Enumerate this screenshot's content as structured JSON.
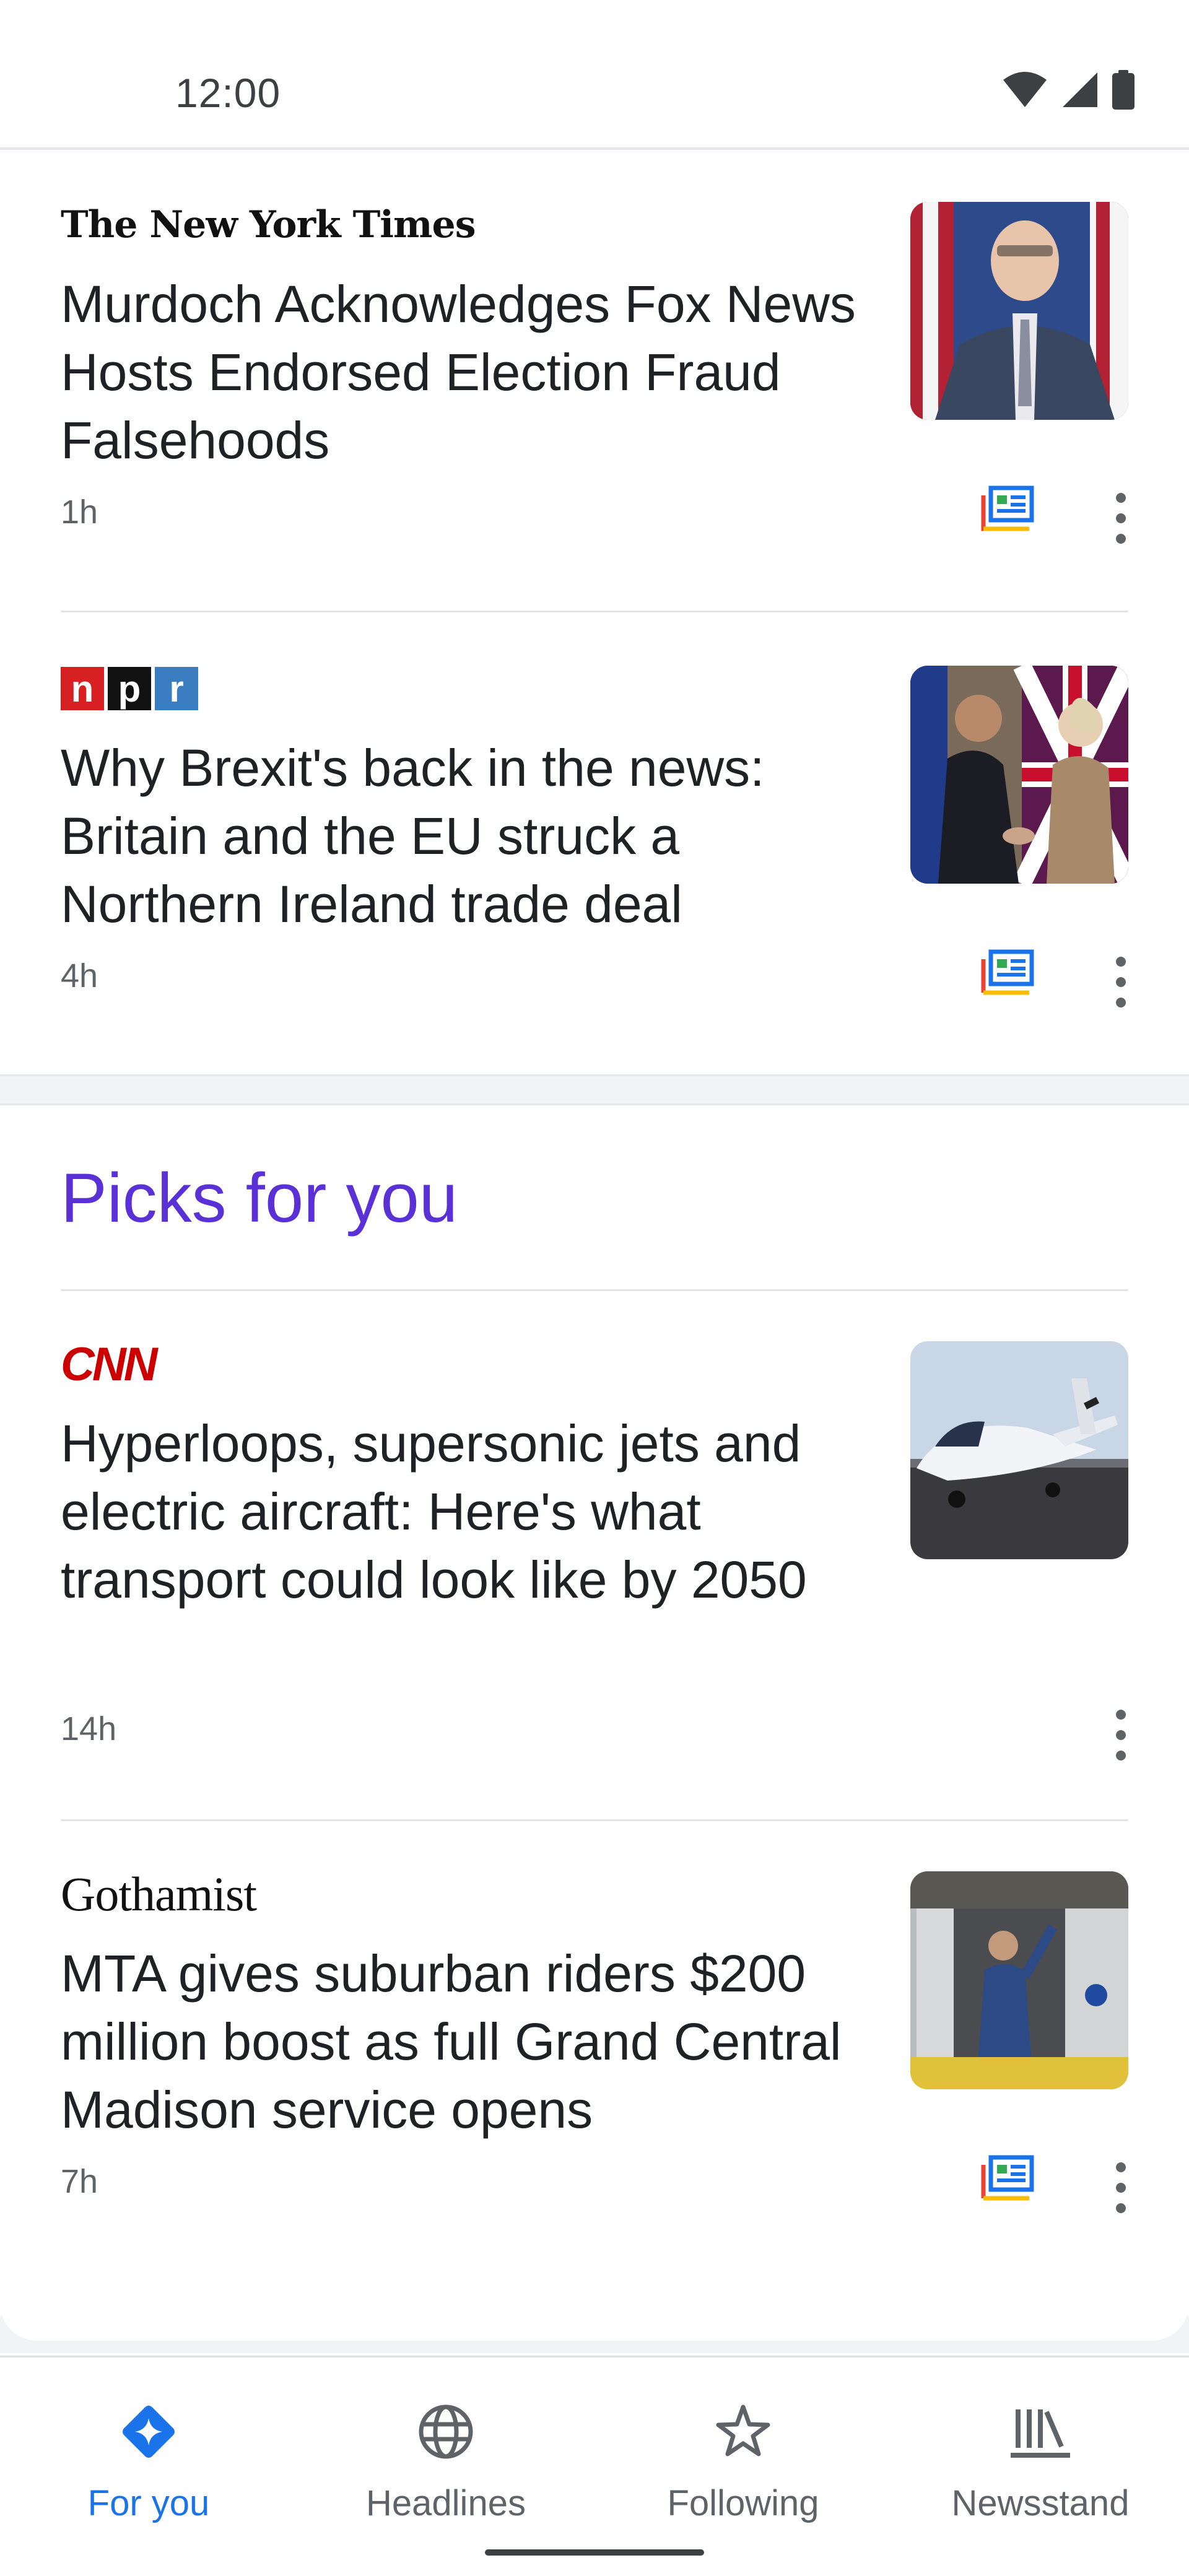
{
  "status_bar": {
    "time": "12:00",
    "icons": [
      "wifi-icon",
      "signal-icon",
      "battery-icon"
    ]
  },
  "feed": {
    "articles": [
      {
        "source": "The New York Times",
        "headline": "Murdoch Acknowledges Fox News Hosts Endorsed Election Fraud Falsehoods",
        "time": "1h",
        "has_full_coverage": true,
        "thumbnail": "man in suit in front of american flags"
      },
      {
        "source": "npr",
        "headline": "Why Brexit's back in the news: Britain and the EU struck a Northern Ireland trade deal",
        "time": "4h",
        "has_full_coverage": true,
        "thumbnail": "two leaders shaking hands in front of flags"
      }
    ]
  },
  "picks": {
    "title": "Picks for you",
    "articles": [
      {
        "source": "CNN",
        "headline": "Hyperloops, supersonic jets and electric aircraft: Here's what transport could look like by 2050",
        "time": "14h",
        "has_full_coverage": false,
        "thumbnail": "small electric airplane on tarmac"
      },
      {
        "source": "Gothamist",
        "headline": "MTA gives suburban riders $200 million boost as full Grand Central Madison service opens",
        "time": "7h",
        "has_full_coverage": true,
        "thumbnail": "woman stepping out of train car"
      }
    ]
  },
  "bottom_nav": {
    "items": [
      {
        "label": "For you",
        "icon": "for-you-icon",
        "active": true
      },
      {
        "label": "Headlines",
        "icon": "globe-icon",
        "active": false
      },
      {
        "label": "Following",
        "icon": "star-icon",
        "active": false
      },
      {
        "label": "Newsstand",
        "icon": "newsstand-icon",
        "active": false
      }
    ]
  },
  "colors": {
    "accent": "#1a73e8",
    "picks_title": "#5a31d6",
    "cnn_red": "#cc0000"
  }
}
